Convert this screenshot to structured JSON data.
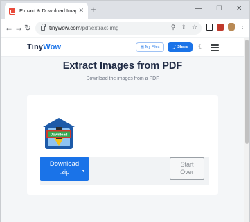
{
  "browser": {
    "tab_title": "Extract & Download Images from",
    "tab_close": "✕",
    "new_tab": "+",
    "window_controls": {
      "minimize": "—",
      "maximize": "☐",
      "close": "✕"
    },
    "nav": {
      "back": "←",
      "forward": "→",
      "reload": "↻"
    },
    "url_host": "tinywow.com",
    "url_path": "/pdf/extract-img",
    "icons": [
      "lock-icon",
      "zoom-icon",
      "share-icon",
      "bookmark-star-icon",
      "extension-box-icon",
      "extension-red-icon",
      "extension-avatar-icon",
      "menu-kebab-icon"
    ]
  },
  "site": {
    "logo_part1": "Tiny",
    "logo_part2": "Wow",
    "my_files_label": "My Files",
    "share_label": "Share",
    "brand_color": "#1a73e8"
  },
  "main": {
    "title": "Extract Images from PDF",
    "subtitle": "Download the images from a PDF",
    "thumbnail_label": "Download",
    "download_button_line1": "Download",
    "download_button_line2": ".zip",
    "start_over_line1": "Start",
    "start_over_line2": "Over"
  }
}
